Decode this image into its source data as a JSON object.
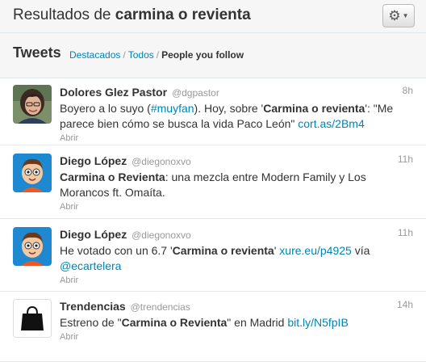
{
  "header": {
    "title_prefix": "Resultados de ",
    "query": "carmina o revienta",
    "gear_icon": "gear-icon"
  },
  "subnav": {
    "tweets_label": "Tweets",
    "filter_top": "Destacados",
    "filter_all": "Todos",
    "filter_following": "People you follow",
    "separator": "/"
  },
  "tweets": [
    {
      "name": "Dolores Glez Pastor",
      "handle": "@dgpastor",
      "time": "8h",
      "segments": [
        {
          "t": "Boyero a lo suyo ("
        },
        {
          "t": "#muyfan",
          "link": true
        },
        {
          "t": "). Hoy, sobre '"
        },
        {
          "t": "Carmina o revienta",
          "bold": true
        },
        {
          "t": "': \"Me parece bien cómo se busca la vida Paco León\" "
        },
        {
          "t": "cort.as/2Bm4",
          "link": true
        }
      ],
      "action": "Abrir",
      "avatar": "photo-avatar"
    },
    {
      "name": "Diego López",
      "handle": "@diegonoxvo",
      "time": "11h",
      "segments": [
        {
          "t": "Carmina o Revienta",
          "bold": true
        },
        {
          "t": ": una mezcla entre Modern Family y Los Morancos ft. Omaíta."
        }
      ],
      "action": "Abrir",
      "avatar": "cartoon-avatar"
    },
    {
      "name": "Diego López",
      "handle": "@diegonoxvo",
      "time": "11h",
      "segments": [
        {
          "t": "He votado con un 6.7 '"
        },
        {
          "t": "Carmina o revienta",
          "bold": true
        },
        {
          "t": "' "
        },
        {
          "t": "xure.eu/p4925",
          "link": true
        },
        {
          "t": " vía "
        },
        {
          "t": "@ecartelera",
          "link": true
        }
      ],
      "action": "Abrir",
      "avatar": "cartoon-avatar"
    },
    {
      "name": "Trendencias",
      "handle": "@trendencias",
      "time": "14h",
      "segments": [
        {
          "t": "Estreno de \""
        },
        {
          "t": "Carmina o Revienta",
          "bold": true
        },
        {
          "t": "\" en Madrid "
        },
        {
          "t": "bit.ly/N5fpIB",
          "link": true
        }
      ],
      "action": "Abrir",
      "avatar": "bag-logo-avatar"
    }
  ]
}
